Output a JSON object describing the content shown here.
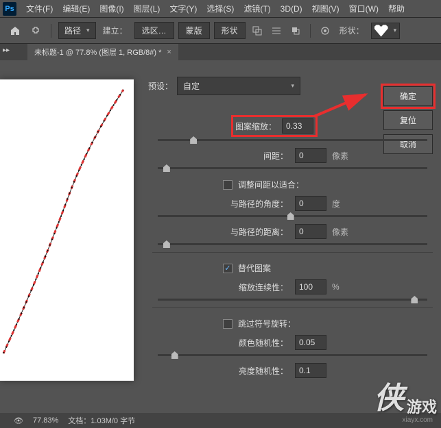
{
  "menu": {
    "items": [
      "文件(F)",
      "编辑(E)",
      "图像(I)",
      "图层(L)",
      "文字(Y)",
      "选择(S)",
      "滤镜(T)",
      "3D(D)",
      "视图(V)",
      "窗口(W)",
      "帮助"
    ]
  },
  "toolbar": {
    "path_mode": "路径",
    "build_label": "建立：",
    "selection_btn": "选区…",
    "mask_btn": "蒙版",
    "shape_btn": "形状",
    "shape_label": "形状："
  },
  "tab": {
    "title": "未标题-1 @ 77.8% (图层 1, RGB/8#) *"
  },
  "dialog": {
    "preset_label": "预设：",
    "preset_value": "自定",
    "pattern_scale_label": "图案缩放：",
    "pattern_scale_value": "0.33",
    "spacing_label": "间距：",
    "spacing_value": "0",
    "spacing_unit": "像素",
    "adjust_spacing_label": "调整间距以适合：",
    "angle_label": "与路径的角度：",
    "angle_value": "0",
    "angle_unit": "度",
    "distance_label": "与路径的距离：",
    "distance_value": "0",
    "distance_unit": "像素",
    "alternate_label": "替代图案",
    "scale_continuity_label": "缩放连续性：",
    "scale_continuity_value": "100",
    "scale_continuity_unit": "%",
    "skip_rotate_label": "跳过符号旋转：",
    "color_random_label": "颜色随机性：",
    "color_random_value": "0.05",
    "brightness_random_label": "亮度随机性：",
    "brightness_random_value": "0.1",
    "ok_btn": "确定",
    "reset_btn": "复位",
    "cancel_btn": "取消"
  },
  "status": {
    "zoom": "77.83%",
    "doc_info": "文档：1.03M/0 字节"
  },
  "watermark": {
    "char": "侠",
    "text": "游戏",
    "url": "xiayx.com"
  }
}
